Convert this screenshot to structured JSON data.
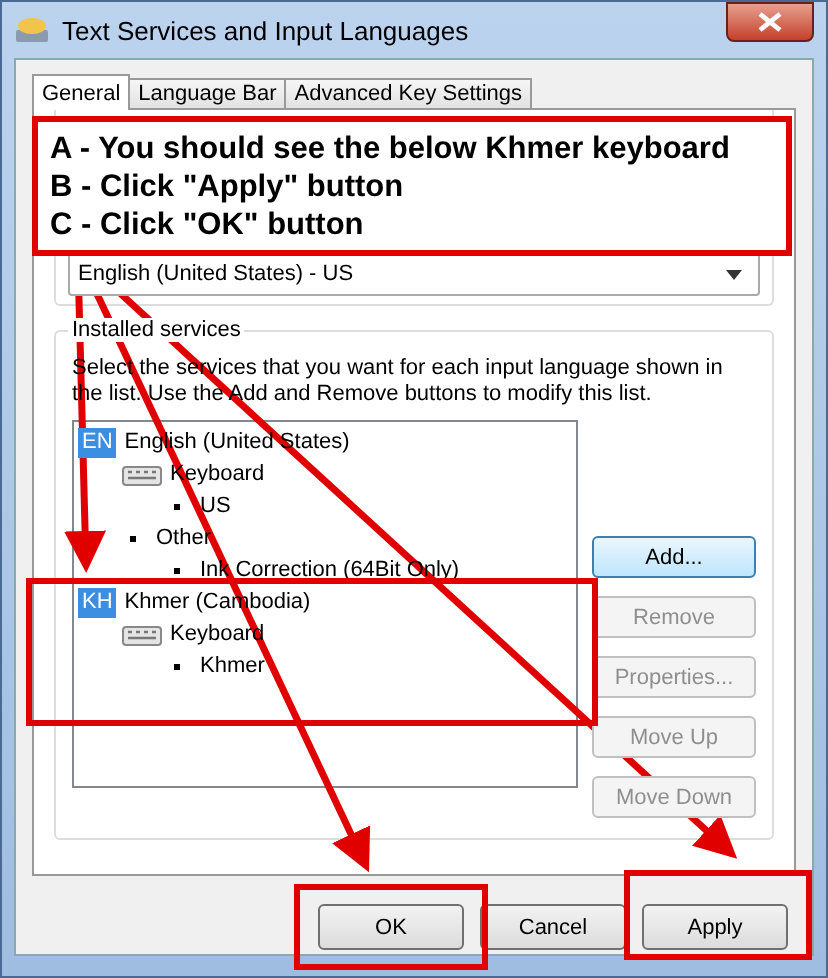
{
  "window": {
    "title": "Text Services and Input Languages"
  },
  "tabs": [
    {
      "label": "General",
      "selected": true
    },
    {
      "label": "Language Bar",
      "selected": false
    },
    {
      "label": "Advanced Key Settings",
      "selected": false
    }
  ],
  "default_language": {
    "value": "English (United States) - US"
  },
  "installed_services": {
    "title": "Installed services",
    "description": "Select the services that you want for each input language shown in the list. Use the Add and Remove buttons to modify this list.",
    "tree": [
      {
        "kind": "language",
        "badge": "EN",
        "label": "English (United States)",
        "children": [
          {
            "kind": "keyboard",
            "label": "Keyboard",
            "children": [
              {
                "kind": "item",
                "label": "US"
              }
            ]
          },
          {
            "kind": "item",
            "label": "Other",
            "children": [
              {
                "kind": "item",
                "label": "Ink Correction (64Bit Only)"
              }
            ]
          }
        ]
      },
      {
        "kind": "language",
        "badge": "KH",
        "label": "Khmer (Cambodia)",
        "children": [
          {
            "kind": "keyboard",
            "label": "Keyboard",
            "children": [
              {
                "kind": "item",
                "label": "Khmer"
              }
            ]
          }
        ]
      }
    ],
    "buttons": [
      {
        "label": "Add...",
        "disabled": false
      },
      {
        "label": "Remove",
        "disabled": true
      },
      {
        "label": "Properties...",
        "disabled": true
      },
      {
        "label": "Move Up",
        "disabled": true
      },
      {
        "label": "Move Down",
        "disabled": true
      }
    ]
  },
  "dialog_buttons": [
    {
      "label": "OK"
    },
    {
      "label": "Cancel"
    },
    {
      "label": "Apply"
    }
  ],
  "callout": [
    "A - You should see the below Khmer keyboard",
    "B - Click \"Apply\" button",
    "C - Click \"OK\" button"
  ]
}
